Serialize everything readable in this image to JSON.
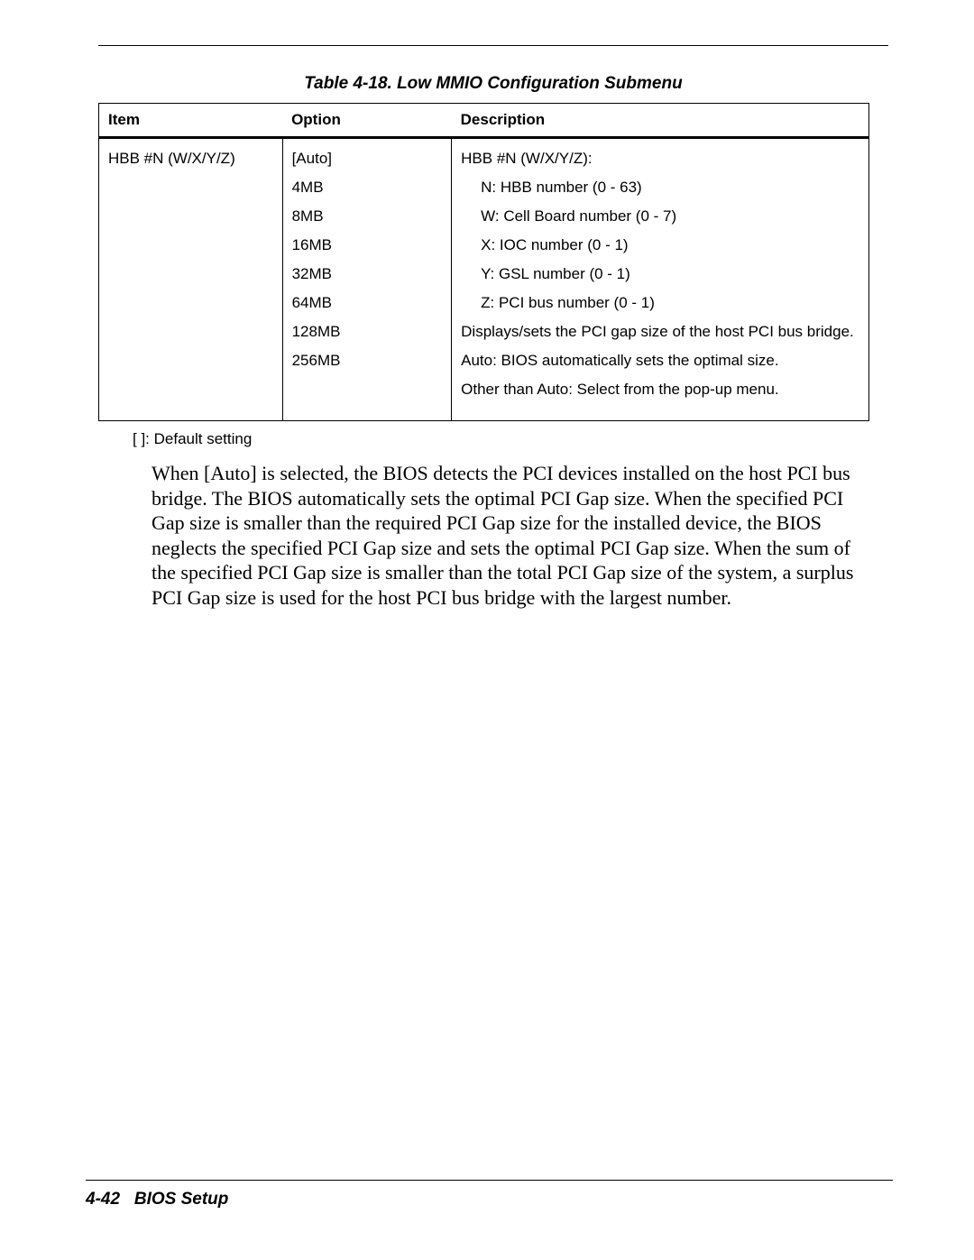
{
  "table": {
    "title": "Table 4-18.  Low MMIO Configuration Submenu",
    "headers": [
      "Item",
      "Option",
      "Description"
    ],
    "row": {
      "item": "HBB #N (W/X/Y/Z)",
      "options": [
        "[Auto]",
        "4MB",
        "8MB",
        "16MB",
        "32MB",
        "64MB",
        "128MB",
        "256MB"
      ],
      "description": [
        "HBB #N (W/X/Y/Z):",
        "N: HBB number (0 - 63)",
        "W: Cell Board number (0 - 7)",
        "X: IOC number (0 - 1)",
        "Y: GSL number (0 - 1)",
        "Z: PCI bus number (0 - 1)",
        "Displays/sets the PCI gap size of the host PCI bus bridge.",
        "Auto: BIOS automatically sets the optimal size.",
        "Other than Auto: Select from the pop-up menu."
      ]
    },
    "default_note": "[       ]: Default setting"
  },
  "body_paragraph": "When [Auto] is selected, the BIOS detects the PCI devices installed on the host PCI bus bridge. The BIOS automatically sets the optimal PCI Gap size. When the specified PCI Gap size is smaller than the required PCI Gap size for the installed device, the BIOS neglects the specified PCI Gap size and sets the optimal PCI Gap size. When the sum of the specified PCI Gap size is smaller than the total PCI Gap size of the system, a surplus PCI Gap size is used for the host PCI bus bridge with the largest number.",
  "footer": {
    "page": "4-42",
    "section": "BIOS Setup"
  }
}
